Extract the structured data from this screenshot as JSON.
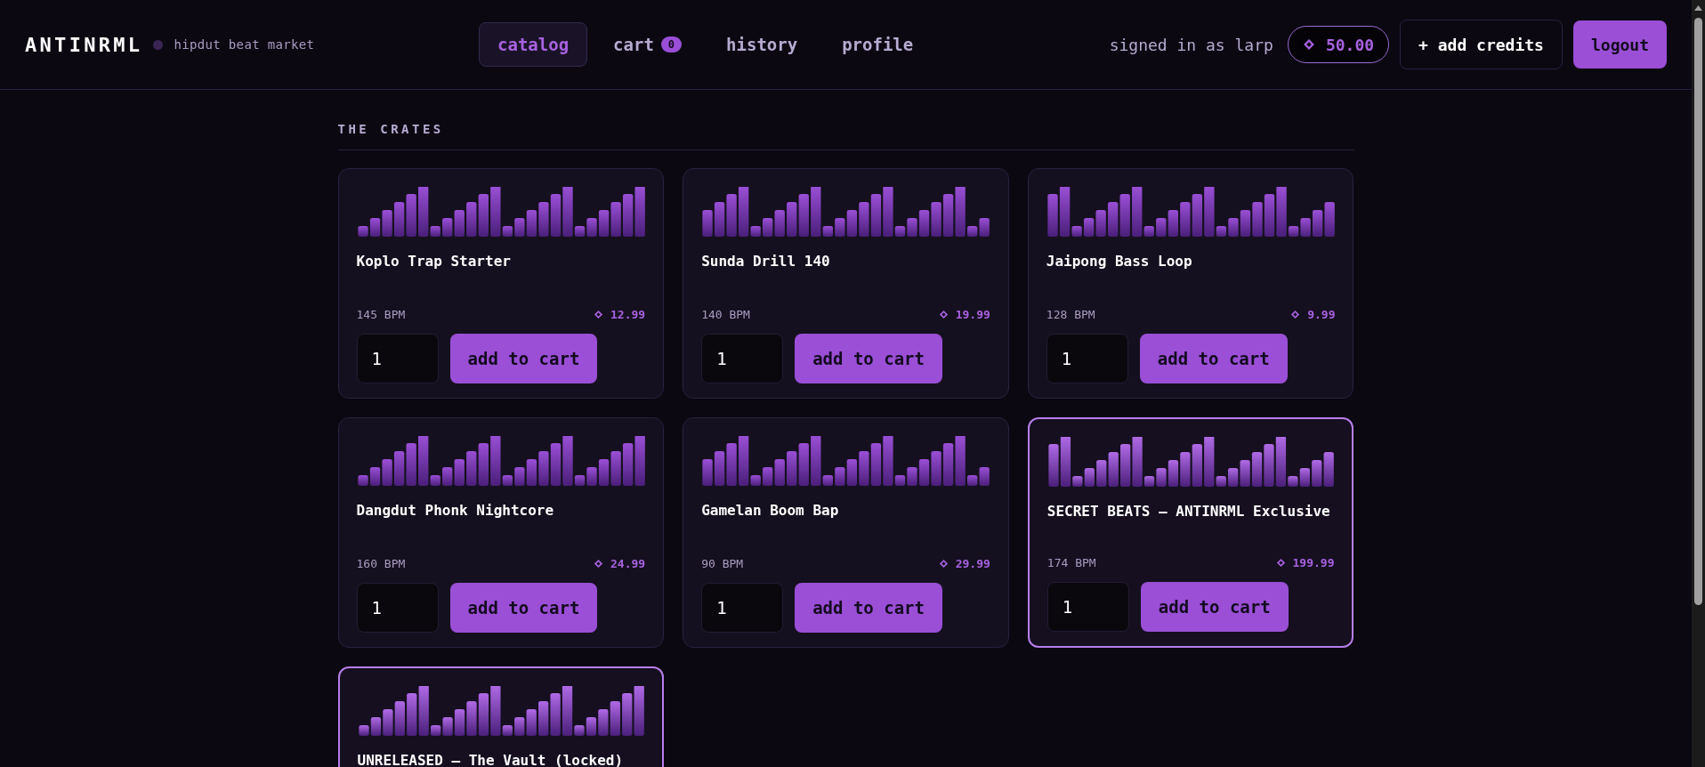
{
  "brand": {
    "name": "ANTINRML",
    "tagline": "hipdut beat market"
  },
  "nav": [
    {
      "label": "catalog",
      "selected": true
    },
    {
      "label": "cart",
      "selected": false,
      "badge": "0"
    },
    {
      "label": "history",
      "selected": false
    },
    {
      "label": "profile",
      "selected": false
    }
  ],
  "account": {
    "signed_in": "signed in as larp",
    "balance": "50.00",
    "add_credits": "+ add credits",
    "logout": "logout"
  },
  "section_title": "THE CRATES",
  "beats": [
    {
      "title": "Koplo Trap Starter",
      "bpm": "145 BPM",
      "price": "12.99",
      "quantity": "1",
      "button": "add to cart",
      "featured": false
    },
    {
      "title": "Sunda Drill 140",
      "bpm": "140 BPM",
      "price": "19.99",
      "quantity": "1",
      "button": "add to cart",
      "featured": false
    },
    {
      "title": "Jaipong Bass Loop",
      "bpm": "128 BPM",
      "price": "9.99",
      "quantity": "1",
      "button": "add to cart",
      "featured": false
    },
    {
      "title": "Dangdut Phonk Nightcore",
      "bpm": "160 BPM",
      "price": "24.99",
      "quantity": "1",
      "button": "add to cart",
      "featured": false
    },
    {
      "title": "Gamelan Boom Bap",
      "bpm": "90 BPM",
      "price": "29.99",
      "quantity": "1",
      "button": "add to cart",
      "featured": false
    },
    {
      "title": "SECRET BEATS — ANTINRML Exclusive",
      "bpm": "174 BPM",
      "price": "199.99",
      "quantity": "1",
      "button": "add to cart",
      "featured": true
    },
    {
      "title": "UNRELEASED — The Vault (locked)",
      "featured": true
    }
  ]
}
